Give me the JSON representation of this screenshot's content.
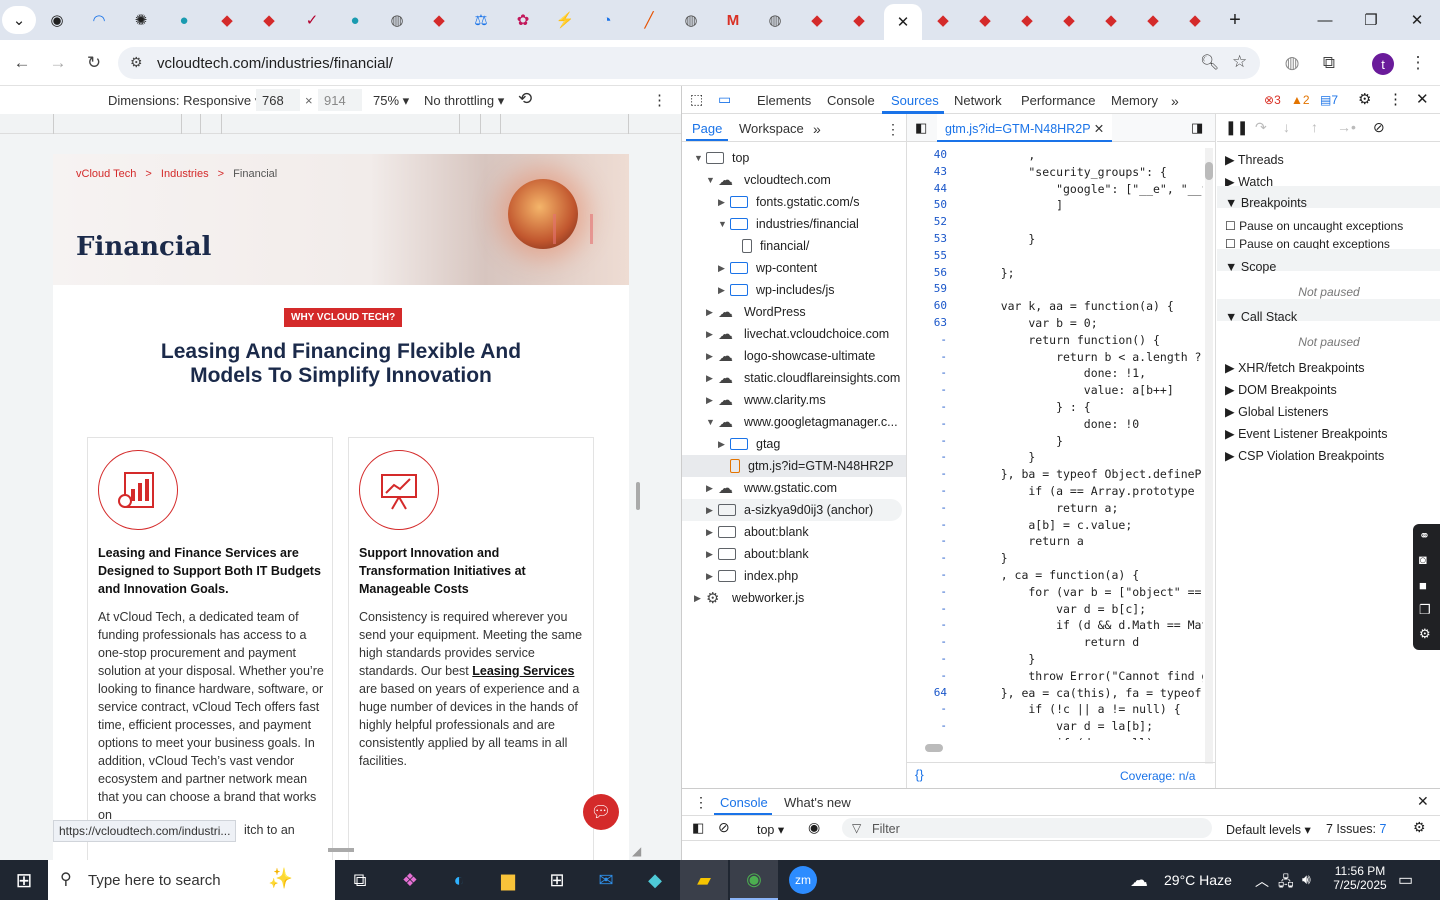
{
  "browser": {
    "active_tab_close": "✕",
    "new_tab": "+",
    "url": "vcloudtech.com/industries/financial/",
    "profile_initial": "t",
    "status_url": "https://vcloudtech.com/industri..."
  },
  "device_toolbar": {
    "dimensions": "Dimensions: Responsive",
    "width": "768",
    "times": "×",
    "height": "914",
    "zoom": "75%",
    "throttling": "No throttling"
  },
  "page": {
    "breadcrumb": [
      "vCloud Tech",
      ">",
      "Industries",
      ">",
      "Financial"
    ],
    "title": "Financial",
    "badge": "WHY VCLOUD TECH?",
    "headline_1": "Leasing And Financing Flexible And",
    "headline_2": "Models To Simplify Innovation",
    "card1_title": "Leasing and Finance Services are Designed to Support Both IT Budgets and Innovation Goals.",
    "card1_body": "At vCloud Tech, a dedicated team of funding professionals has access to a one-stop procurement and payment solution at your disposal. Whether you’re looking to finance hardware, software, or service contract, vCloud Tech offers fast time, efficient processes, and payment options to meet your business goals. In addition, vCloud Tech’s vast vendor ecosystem and partner network mean that you can choose a brand that works on",
    "card1_tail": "itch to an",
    "card2_title": "Support Innovation and Transformation Initiatives at Manageable Costs",
    "card2_body_a": "Consistency is required wherever you send your equipment. Meeting the same high standards provides service standards. Our best",
    "card2_link": "Leasing Services",
    "card2_body_b": "are based on years of experience and a huge number of devices in the hands of highly helpful professionals and are consistently applied by all teams in all facilities."
  },
  "devtools": {
    "tabs": [
      "Elements",
      "Console",
      "Sources",
      "Network",
      "Performance",
      "Memory"
    ],
    "active_tab": "Sources",
    "errors": "3",
    "warnings": "2",
    "messages": "7",
    "nav_tabs": [
      "Page",
      "Workspace"
    ],
    "open_file": "gtm.js?id=GTM-N48HR2P",
    "tree": [
      {
        "label": "top",
        "depth": 0,
        "icon": "frame",
        "tri": "▼"
      },
      {
        "label": "vcloudtech.com",
        "depth": 1,
        "icon": "cloud",
        "tri": "▼"
      },
      {
        "label": "fonts.gstatic.com/s",
        "depth": 2,
        "icon": "folder",
        "tri": "▶"
      },
      {
        "label": "industries/financial",
        "depth": 2,
        "icon": "folder",
        "tri": "▼"
      },
      {
        "label": "financial/",
        "depth": 3,
        "icon": "file",
        "tri": ""
      },
      {
        "label": "wp-content",
        "depth": 2,
        "icon": "folder",
        "tri": "▶"
      },
      {
        "label": "wp-includes/js",
        "depth": 2,
        "icon": "folder",
        "tri": "▶"
      },
      {
        "label": "WordPress",
        "depth": 1,
        "icon": "cloud",
        "tri": "▶"
      },
      {
        "label": "livechat.vcloudchoice.com",
        "depth": 1,
        "icon": "cloud",
        "tri": "▶"
      },
      {
        "label": "logo-showcase-ultimate",
        "depth": 1,
        "icon": "cloud",
        "tri": "▶"
      },
      {
        "label": "static.cloudflareinsights.com",
        "depth": 1,
        "icon": "cloud",
        "tri": "▶"
      },
      {
        "label": "www.clarity.ms",
        "depth": 1,
        "icon": "cloud",
        "tri": "▶"
      },
      {
        "label": "www.googletagmanager.c...",
        "depth": 1,
        "icon": "cloud",
        "tri": "▼"
      },
      {
        "label": "gtag",
        "depth": 2,
        "icon": "folder",
        "tri": "▶"
      },
      {
        "label": "gtm.js?id=GTM-N48HR2P",
        "depth": 2,
        "icon": "jsfile",
        "tri": ""
      },
      {
        "label": "www.gstatic.com",
        "depth": 1,
        "icon": "cloud",
        "tri": "▶"
      },
      {
        "label": "a-sizkya9d0ij3 (anchor)",
        "depth": 1,
        "icon": "frame",
        "tri": "▶"
      },
      {
        "label": "about:blank",
        "depth": 1,
        "icon": "frame",
        "tri": "▶"
      },
      {
        "label": "about:blank",
        "depth": 1,
        "icon": "frame",
        "tri": "▶"
      },
      {
        "label": "index.php",
        "depth": 1,
        "icon": "frame",
        "tri": "▶"
      },
      {
        "label": "webworker.js",
        "depth": 0,
        "icon": "gear",
        "tri": "▶"
      }
    ],
    "code_lines": [
      {
        "n": "40",
        "t": "        ,"
      },
      {
        "n": "43",
        "t": "        \"security_groups\": {"
      },
      {
        "n": "44",
        "t": "            \"google\": [\"__e\", \"__f\""
      },
      {
        "n": "50",
        "t": "            ]"
      },
      {
        "n": "52",
        "t": ""
      },
      {
        "n": "53",
        "t": "        }"
      },
      {
        "n": "55",
        "t": ""
      },
      {
        "n": "56",
        "t": "    };"
      },
      {
        "n": "59",
        "t": ""
      },
      {
        "n": "60",
        "t": "    var k, aa = function(a) {"
      },
      {
        "n": "63",
        "t": "        var b = 0;"
      },
      {
        "n": "-",
        "t": "        return function() {"
      },
      {
        "n": "-",
        "t": "            return b < a.length ? {"
      },
      {
        "n": "-",
        "t": "                done: !1,"
      },
      {
        "n": "-",
        "t": "                value: a[b++]"
      },
      {
        "n": "-",
        "t": "            } : {"
      },
      {
        "n": "-",
        "t": "                done: !0"
      },
      {
        "n": "-",
        "t": "            }"
      },
      {
        "n": "-",
        "t": "        }"
      },
      {
        "n": "-",
        "t": "    }, ba = typeof Object.definePro"
      },
      {
        "n": "-",
        "t": "        if (a == Array.prototype ||"
      },
      {
        "n": "-",
        "t": "            return a;"
      },
      {
        "n": "-",
        "t": "        a[b] = c.value;"
      },
      {
        "n": "-",
        "t": "        return a"
      },
      {
        "n": "-",
        "t": "    }"
      },
      {
        "n": "-",
        "t": "    , ca = function(a) {"
      },
      {
        "n": "-",
        "t": "        for (var b = [\"object\" == t"
      },
      {
        "n": "-",
        "t": "            var d = b[c];"
      },
      {
        "n": "-",
        "t": "            if (d && d.Math == Math"
      },
      {
        "n": "-",
        "t": "                return d"
      },
      {
        "n": "-",
        "t": "        }"
      },
      {
        "n": "-",
        "t": "        throw Error(\"Cannot find gl"
      },
      {
        "n": "64",
        "t": "    }, ea = ca(this), fa = typeof S"
      },
      {
        "n": "-",
        "t": "        if (!c || a != null) {"
      },
      {
        "n": "-",
        "t": "            var d = la[b];"
      },
      {
        "n": "-",
        "t": "            if (d == null)"
      }
    ],
    "coverage": "Coverage: n/a",
    "debugger": {
      "threads": "Threads",
      "watch": "Watch",
      "breakpoints": "Breakpoints",
      "pause_uncaught": "Pause on uncaught exceptions",
      "pause_caught": "Pause on caught exceptions",
      "scope": "Scope",
      "not_paused_1": "Not paused",
      "call_stack": "Call Stack",
      "not_paused_2": "Not paused",
      "xhr": "XHR/fetch Breakpoints",
      "dom": "DOM Breakpoints",
      "global": "Global Listeners",
      "event": "Event Listener Breakpoints",
      "csp": "CSP Violation Breakpoints"
    },
    "drawer_tabs": [
      "Console",
      "What's new"
    ],
    "context": "top",
    "filter_placeholder": "Filter",
    "levels": "Default levels",
    "issues": "7 Issues:",
    "issues_count": "7"
  },
  "taskbar": {
    "search_placeholder": "Type here to search",
    "weather": "29°C  Haze",
    "time": "11:56 PM",
    "date": "7/25/2025"
  },
  "colors": {
    "accent": "#1a73e8",
    "brand_red": "#d42a2a",
    "dark_navy": "#1b2a4a"
  }
}
